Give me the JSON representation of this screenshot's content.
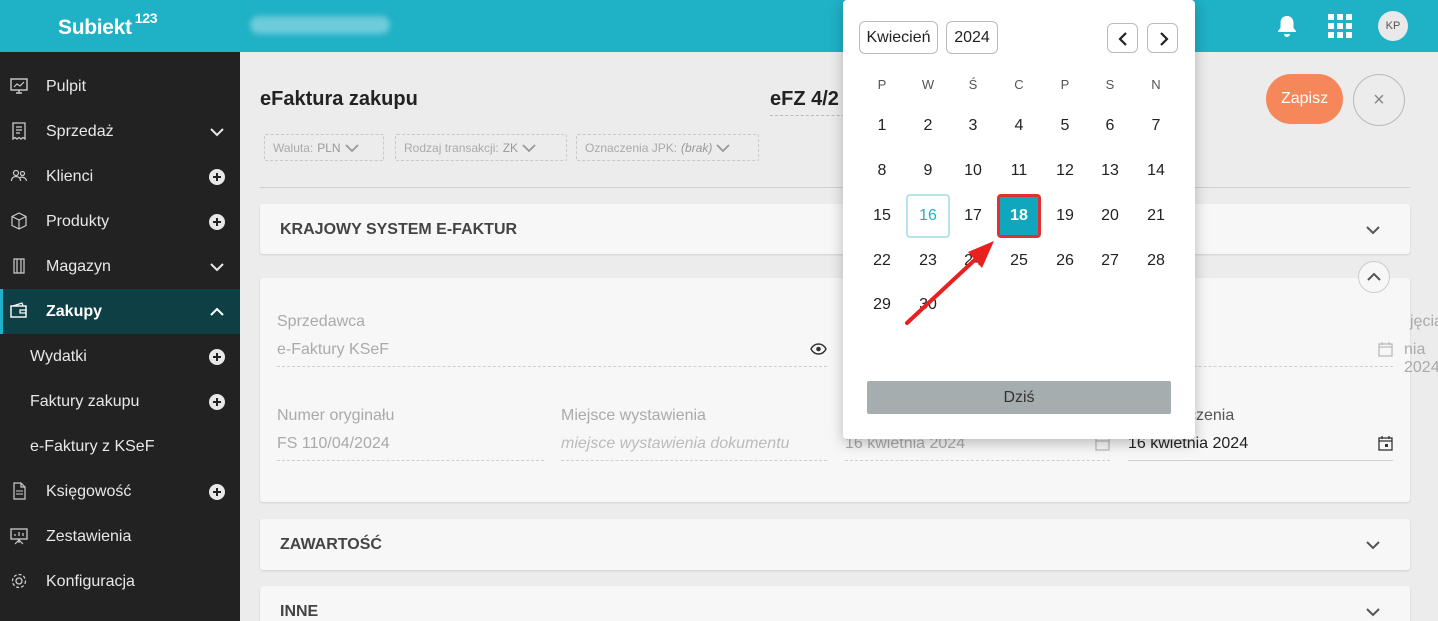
{
  "header": {
    "logo": "Subiekt",
    "logo_sup": "123",
    "avatar_initials": "KP"
  },
  "sidebar": {
    "items": [
      {
        "label": "Pulpit",
        "trail": "none"
      },
      {
        "label": "Sprzedaż",
        "trail": "chevron-down"
      },
      {
        "label": "Klienci",
        "trail": "plus"
      },
      {
        "label": "Produkty",
        "trail": "plus"
      },
      {
        "label": "Magazyn",
        "trail": "chevron-down"
      },
      {
        "label": "Zakupy",
        "trail": "chevron-up"
      },
      {
        "label": "Wydatki",
        "trail": "plus"
      },
      {
        "label": "Faktury zakupu",
        "trail": "plus"
      },
      {
        "label": "e-Faktury z KSeF",
        "trail": "none"
      },
      {
        "label": "Księgowość",
        "trail": "plus"
      },
      {
        "label": "Zestawienia",
        "trail": "none"
      },
      {
        "label": "Konfiguracja",
        "trail": "none"
      }
    ]
  },
  "main": {
    "title": "eFaktura zakupu",
    "doc_number": "eFZ 4/2",
    "chips": [
      {
        "label": "Waluta:",
        "value": "PLN"
      },
      {
        "label": "Rodzaj transakcji:",
        "value": "ZK"
      },
      {
        "label": "Oznaczenia JPK:",
        "value": "(brak)"
      }
    ],
    "save_label": "Zapisz",
    "close_label": "×",
    "sections": {
      "ksef": "KRAJOWY SYSTEM E-FAKTUR",
      "zawartosc": "ZAWARTOŚĆ",
      "inne": "INNE"
    },
    "fields": {
      "seller_label": "Sprzedawca",
      "seller_value": "e-Faktury KSeF",
      "receipt_label_partial": "jęcia",
      "receipt_value_partial": "nia 2024",
      "original_no_label": "Numer oryginału",
      "original_no_value": "FS 110/04/2024",
      "place_label": "Miejsce wystawienia",
      "place_placeholder": "miejsce wystawienia dokumentu",
      "issue_date_value": "16 kwietnia 2024",
      "delivery_label_partial": "czenia",
      "delivery_value": "16 kwietnia 2024"
    }
  },
  "calendar": {
    "month": "Kwiecień",
    "year": "2024",
    "weekdays": [
      "P",
      "W",
      "Ś",
      "C",
      "P",
      "S",
      "N"
    ],
    "weeks": [
      [
        "1",
        "2",
        "3",
        "4",
        "5",
        "6",
        "7"
      ],
      [
        "8",
        "9",
        "10",
        "11",
        "12",
        "13",
        "14"
      ],
      [
        "15",
        "16",
        "17",
        "18",
        "19",
        "20",
        "21"
      ],
      [
        "22",
        "23",
        "24",
        "25",
        "26",
        "27",
        "28"
      ],
      [
        "29",
        "30",
        "",
        "",
        "",
        "",
        ""
      ]
    ],
    "today_day": "16",
    "selected_day": "18",
    "today_button": "Dziś"
  },
  "colors": {
    "accent": "#1fb1c6",
    "sidebar_bg": "#222222",
    "save_button": "#f6875a",
    "annotation_arrow": "#e82020"
  }
}
